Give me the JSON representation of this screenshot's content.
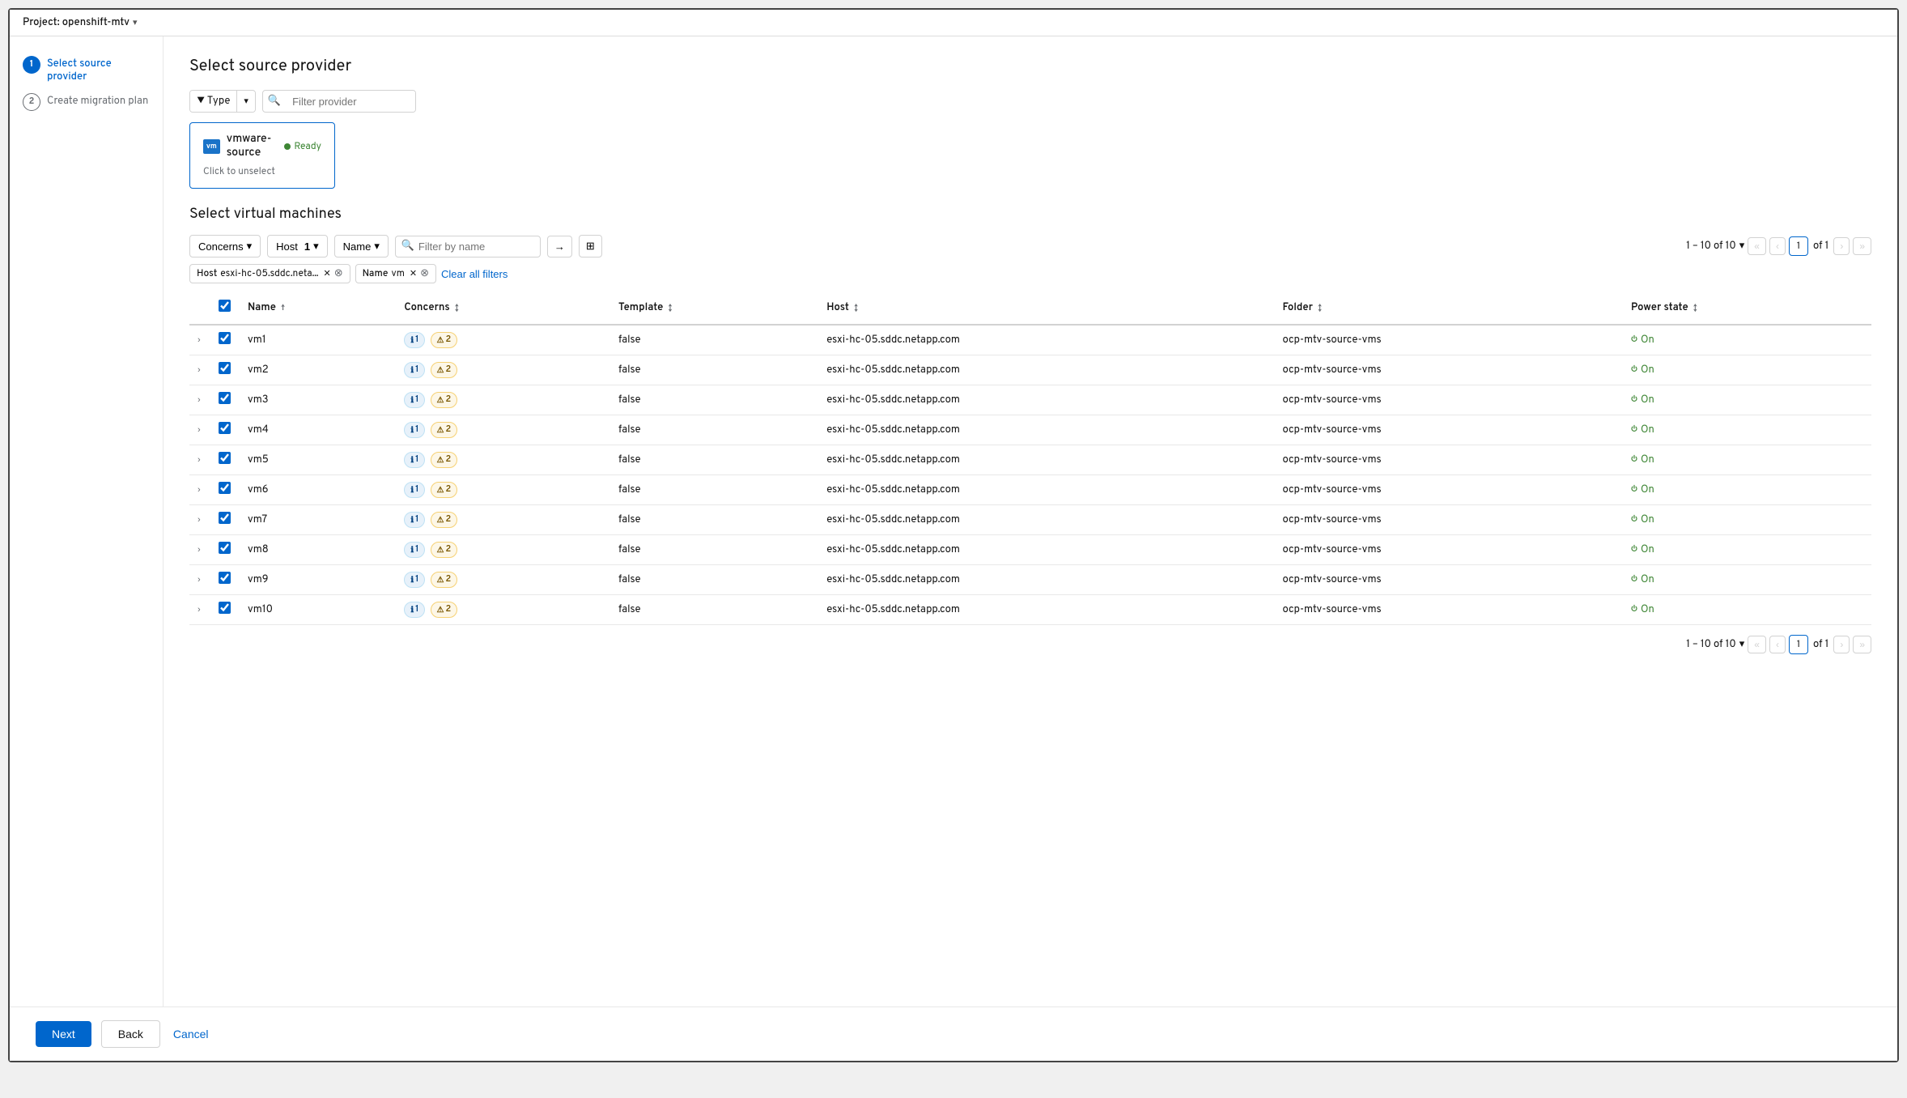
{
  "project": {
    "label": "Project: openshift-mtv",
    "arrow": "▾"
  },
  "sidebar": {
    "steps": [
      {
        "number": "1",
        "label": "Select source provider",
        "state": "active"
      },
      {
        "number": "2",
        "label": "Create migration plan",
        "state": "inactive"
      }
    ]
  },
  "source_provider": {
    "section_title": "Select source provider",
    "filter": {
      "type_label": "Type",
      "placeholder": "Filter provider"
    },
    "provider_card": {
      "logo_text": "vm",
      "name": "vmware-source",
      "status": "Ready",
      "hint": "Click to unselect"
    }
  },
  "virtual_machines": {
    "section_title": "Select virtual machines",
    "filters": {
      "concerns_label": "Concerns",
      "host_label": "Host",
      "host_value": "1",
      "name_label": "Name",
      "search_placeholder": "Filter by name"
    },
    "active_filters": {
      "host_tag_label": "Host",
      "host_tag_value": "esxi-hc-05.sddc.neta...",
      "name_tag_label": "Name",
      "name_tag_value": "vm",
      "clear_all": "Clear all filters"
    },
    "pagination_top": {
      "range": "1 – 10 of 10",
      "of_label": "of 1",
      "current_page": "1"
    },
    "pagination_bottom": {
      "range": "1 – 10 of 10",
      "of_label": "of 1",
      "current_page": "1"
    },
    "table": {
      "columns": [
        "Name",
        "Concerns",
        "Template",
        "Host",
        "Folder",
        "Power state"
      ],
      "rows": [
        {
          "name": "vm1",
          "info_count": "1",
          "warn_count": "2",
          "template": "false",
          "host": "esxi-hc-05.sddc.netapp.com",
          "folder": "ocp-mtv-source-vms",
          "power": "On"
        },
        {
          "name": "vm2",
          "info_count": "1",
          "warn_count": "2",
          "template": "false",
          "host": "esxi-hc-05.sddc.netapp.com",
          "folder": "ocp-mtv-source-vms",
          "power": "On"
        },
        {
          "name": "vm3",
          "info_count": "1",
          "warn_count": "2",
          "template": "false",
          "host": "esxi-hc-05.sddc.netapp.com",
          "folder": "ocp-mtv-source-vms",
          "power": "On"
        },
        {
          "name": "vm4",
          "info_count": "1",
          "warn_count": "2",
          "template": "false",
          "host": "esxi-hc-05.sddc.netapp.com",
          "folder": "ocp-mtv-source-vms",
          "power": "On"
        },
        {
          "name": "vm5",
          "info_count": "1",
          "warn_count": "2",
          "template": "false",
          "host": "esxi-hc-05.sddc.netapp.com",
          "folder": "ocp-mtv-source-vms",
          "power": "On"
        },
        {
          "name": "vm6",
          "info_count": "1",
          "warn_count": "2",
          "template": "false",
          "host": "esxi-hc-05.sddc.netapp.com",
          "folder": "ocp-mtv-source-vms",
          "power": "On"
        },
        {
          "name": "vm7",
          "info_count": "1",
          "warn_count": "2",
          "template": "false",
          "host": "esxi-hc-05.sddc.netapp.com",
          "folder": "ocp-mtv-source-vms",
          "power": "On"
        },
        {
          "name": "vm8",
          "info_count": "1",
          "warn_count": "2",
          "template": "false",
          "host": "esxi-hc-05.sddc.netapp.com",
          "folder": "ocp-mtv-source-vms",
          "power": "On"
        },
        {
          "name": "vm9",
          "info_count": "1",
          "warn_count": "2",
          "template": "false",
          "host": "esxi-hc-05.sddc.netapp.com",
          "folder": "ocp-mtv-source-vms",
          "power": "On"
        },
        {
          "name": "vm10",
          "info_count": "1",
          "warn_count": "2",
          "template": "false",
          "host": "esxi-hc-05.sddc.netapp.com",
          "folder": "ocp-mtv-source-vms",
          "power": "On"
        }
      ]
    }
  },
  "footer": {
    "next_label": "Next",
    "back_label": "Back",
    "cancel_label": "Cancel"
  }
}
